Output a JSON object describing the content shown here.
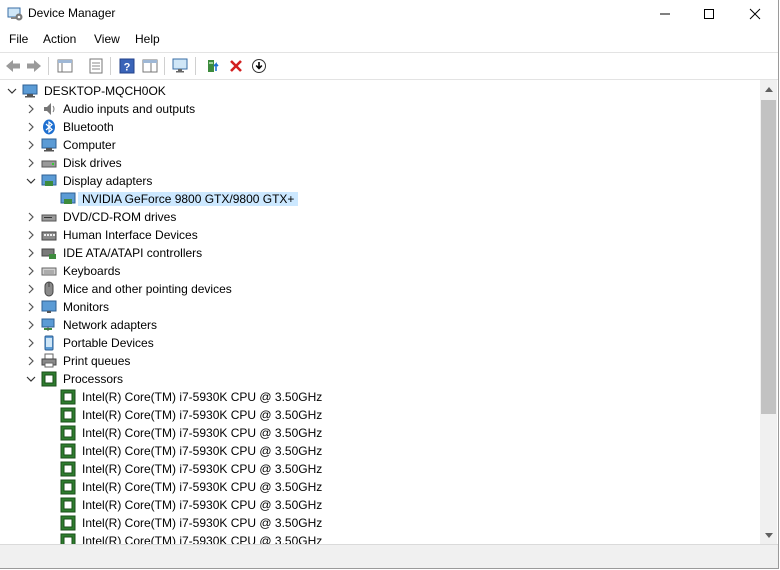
{
  "window": {
    "title": "Device Manager"
  },
  "menu": {
    "file": "File",
    "action": "Action",
    "view": "View",
    "help": "Help"
  },
  "tree": {
    "root": "DESKTOP-MQCH0OK",
    "audio": "Audio inputs and outputs",
    "bluetooth": "Bluetooth",
    "computer": "Computer",
    "disk": "Disk drives",
    "display": "Display adapters",
    "gpu": "NVIDIA GeForce 9800 GTX/9800 GTX+",
    "dvd": "DVD/CD-ROM drives",
    "hid": "Human Interface Devices",
    "ide": "IDE ATA/ATAPI controllers",
    "keyboards": "Keyboards",
    "mice": "Mice and other pointing devices",
    "monitors": "Monitors",
    "network": "Network adapters",
    "portable": "Portable Devices",
    "print": "Print queues",
    "processors": "Processors",
    "cpu": "Intel(R) Core(TM) i7-5930K CPU @ 3.50GHz"
  },
  "colors": {
    "selection": "#cce8ff",
    "accent": "#1e6fd0",
    "delete": "#d21f1f"
  }
}
